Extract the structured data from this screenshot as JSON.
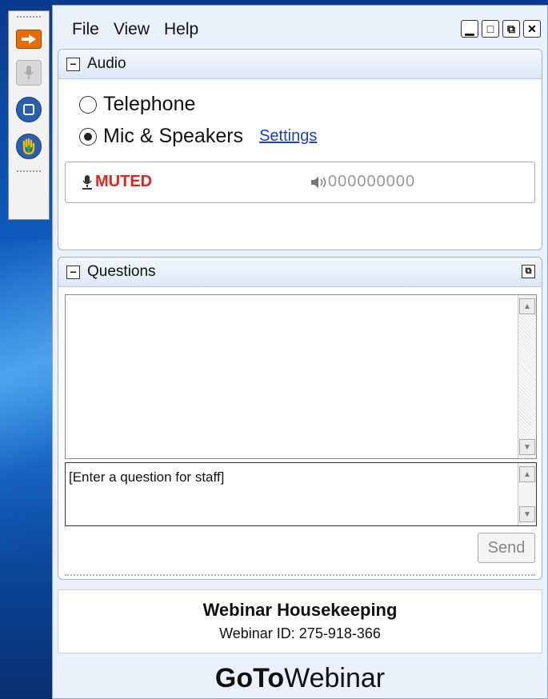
{
  "menu": {
    "file": "File",
    "view": "View",
    "help": "Help"
  },
  "window_controls": {
    "minimize_glyph": "▁",
    "restore_glyph": "□",
    "popout_glyph": "⧉",
    "close_glyph": "✕"
  },
  "audio": {
    "title": "Audio",
    "collapse_glyph": "−",
    "telephone_label": "Telephone",
    "mic_label": "Mic & Speakers",
    "selected": "Mic & Speakers",
    "settings_link": "Settings",
    "mic_status": "MUTED",
    "speaker_meter": "000000000"
  },
  "questions": {
    "title": "Questions",
    "collapse_glyph": "−",
    "popout_glyph": "⧉",
    "input_placeholder": "[Enter a question for staff]",
    "send_label": "Send"
  },
  "webinar": {
    "title": "Webinar Housekeeping",
    "id_text": "Webinar ID: 275-918-366"
  },
  "brand": {
    "bold": "GoTo",
    "regular": "Webinar"
  },
  "colors": {
    "muted_red": "#e0241c",
    "link_blue": "#1a3fd0",
    "accent_orange": "#e86d00"
  }
}
